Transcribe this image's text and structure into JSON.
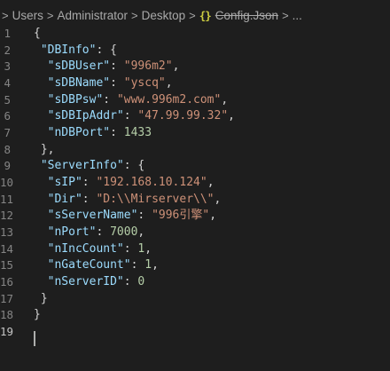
{
  "breadcrumb": {
    "items": [
      "Users",
      "Administrator",
      "Desktop"
    ],
    "separator": ">",
    "file_icon": "{}",
    "file_name": "Config.Json",
    "ellipsis": "..."
  },
  "editor": {
    "language": "json",
    "active_line": 19,
    "lines": [
      {
        "num": "1",
        "tokens": [
          [
            "p",
            "{"
          ]
        ]
      },
      {
        "num": "2",
        "tokens": [
          [
            "p",
            " "
          ],
          [
            "k",
            "\"DBInfo\""
          ],
          [
            "p",
            ": {"
          ]
        ]
      },
      {
        "num": "3",
        "tokens": [
          [
            "p",
            "  "
          ],
          [
            "k",
            "\"sDBUser\""
          ],
          [
            "p",
            ": "
          ],
          [
            "s",
            "\"996m2\""
          ],
          [
            "p",
            ","
          ]
        ]
      },
      {
        "num": "4",
        "tokens": [
          [
            "p",
            "  "
          ],
          [
            "k",
            "\"sDBName\""
          ],
          [
            "p",
            ": "
          ],
          [
            "s",
            "\"yscq\""
          ],
          [
            "p",
            ","
          ]
        ]
      },
      {
        "num": "5",
        "tokens": [
          [
            "p",
            "  "
          ],
          [
            "k",
            "\"sDBPsw\""
          ],
          [
            "p",
            ": "
          ],
          [
            "s",
            "\"www.996m2.com\""
          ],
          [
            "p",
            ","
          ]
        ]
      },
      {
        "num": "6",
        "tokens": [
          [
            "p",
            "  "
          ],
          [
            "k",
            "\"sDBIpAddr\""
          ],
          [
            "p",
            ": "
          ],
          [
            "s",
            "\"47.99.99.32\""
          ],
          [
            "p",
            ","
          ]
        ]
      },
      {
        "num": "7",
        "tokens": [
          [
            "p",
            "  "
          ],
          [
            "k",
            "\"nDBPort\""
          ],
          [
            "p",
            ": "
          ],
          [
            "n",
            "1433"
          ]
        ]
      },
      {
        "num": "8",
        "tokens": [
          [
            "p",
            " },"
          ]
        ]
      },
      {
        "num": "9",
        "tokens": [
          [
            "p",
            " "
          ],
          [
            "k",
            "\"ServerInfo\""
          ],
          [
            "p",
            ": {"
          ]
        ]
      },
      {
        "num": "10",
        "tokens": [
          [
            "p",
            "  "
          ],
          [
            "k",
            "\"sIP\""
          ],
          [
            "p",
            ": "
          ],
          [
            "s",
            "\"192.168.10.124\""
          ],
          [
            "p",
            ","
          ]
        ]
      },
      {
        "num": "11",
        "tokens": [
          [
            "p",
            "  "
          ],
          [
            "k",
            "\"Dir\""
          ],
          [
            "p",
            ": "
          ],
          [
            "s",
            "\"D:\\\\Mirserver\\\\\""
          ],
          [
            "p",
            ","
          ]
        ]
      },
      {
        "num": "12",
        "tokens": [
          [
            "p",
            "  "
          ],
          [
            "k",
            "\"sServerName\""
          ],
          [
            "p",
            ": "
          ],
          [
            "s",
            "\"996引擎\""
          ],
          [
            "p",
            ","
          ]
        ]
      },
      {
        "num": "13",
        "tokens": [
          [
            "p",
            "  "
          ],
          [
            "k",
            "\"nPort\""
          ],
          [
            "p",
            ": "
          ],
          [
            "n",
            "7000"
          ],
          [
            "p",
            ","
          ]
        ]
      },
      {
        "num": "14",
        "tokens": [
          [
            "p",
            "  "
          ],
          [
            "k",
            "\"nIncCount\""
          ],
          [
            "p",
            ": "
          ],
          [
            "n",
            "1"
          ],
          [
            "p",
            ","
          ]
        ]
      },
      {
        "num": "15",
        "tokens": [
          [
            "p",
            "  "
          ],
          [
            "k",
            "\"nGateCount\""
          ],
          [
            "p",
            ": "
          ],
          [
            "n",
            "1"
          ],
          [
            "p",
            ","
          ]
        ]
      },
      {
        "num": "16",
        "tokens": [
          [
            "p",
            "  "
          ],
          [
            "k",
            "\"nServerID\""
          ],
          [
            "p",
            ": "
          ],
          [
            "n",
            "0"
          ]
        ]
      },
      {
        "num": "17",
        "tokens": [
          [
            "p",
            " }"
          ]
        ]
      },
      {
        "num": "18",
        "tokens": [
          [
            "p",
            "}"
          ]
        ]
      },
      {
        "num": "19",
        "tokens": []
      }
    ]
  },
  "colors": {
    "background": "#1e1e1e",
    "key": "#9cdcfe",
    "string": "#ce9178",
    "number": "#b5cea8",
    "punctuation": "#d4d4d4",
    "line_number": "#858585",
    "json_icon": "#cbcb41"
  }
}
